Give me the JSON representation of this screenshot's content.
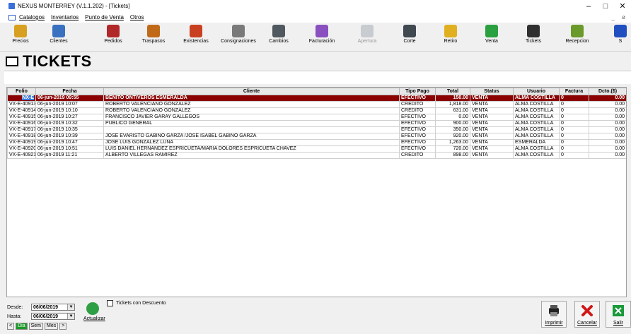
{
  "window": {
    "title": "NEXUS MONTERREY (V.1.1.202) - [Tickets]",
    "controls": [
      "–",
      "□",
      "✕"
    ]
  },
  "menu": {
    "items": [
      "Catalogos",
      "Inventarios",
      "Punto de Venta",
      "Otros"
    ],
    "mdi_controls": "_ ø"
  },
  "toolbar": [
    {
      "label": "Precios",
      "icon": "price-tag-icon",
      "color": "#d8a020",
      "enabled": true
    },
    {
      "label": "Clientes",
      "icon": "customers-icon",
      "color": "#3a70c0",
      "enabled": true
    },
    {
      "label": "Pedidos",
      "icon": "orders-icon",
      "color": "#b02828",
      "enabled": true
    },
    {
      "label": "Traspasos",
      "icon": "transfer-icon",
      "color": "#c06a18",
      "enabled": true
    },
    {
      "label": "Existencias",
      "icon": "stock-icon",
      "color": "#c84020",
      "enabled": true
    },
    {
      "label": "Consignaciones",
      "icon": "consignment-icon",
      "color": "#7a7a7a",
      "enabled": true
    },
    {
      "label": "Cambios",
      "icon": "exchange-icon",
      "color": "#505860",
      "enabled": true
    },
    {
      "label": "Facturación",
      "icon": "invoice-icon",
      "color": "#8a50c0",
      "enabled": true
    },
    {
      "label": "Apertura",
      "icon": "opening-icon",
      "color": "#c8ccd0",
      "enabled": false
    },
    {
      "label": "Corte",
      "icon": "cash-register-icon",
      "color": "#404850",
      "enabled": true
    },
    {
      "label": "Retiro",
      "icon": "withdrawal-icon",
      "color": "#e0b020",
      "enabled": true
    },
    {
      "label": "Venta",
      "icon": "sale-icon",
      "color": "#2aa040",
      "enabled": true
    },
    {
      "label": "Tickets",
      "icon": "ticket-icon",
      "color": "#303030",
      "enabled": true
    },
    {
      "label": "Recepcion",
      "icon": "reception-icon",
      "color": "#6a9a2a",
      "enabled": true
    },
    {
      "label": "S",
      "icon": "more-icon",
      "color": "#2050c0",
      "enabled": true
    }
  ],
  "page": {
    "title": "TICKETS"
  },
  "table": {
    "columns": [
      "Folio",
      "Fecha",
      "Cliente",
      "Tipo Pago",
      "Total",
      "Status",
      "Usuario",
      "Factura",
      "Dcto.($)"
    ],
    "rows": [
      [
        "NX-E",
        "06-jun-2019 09:55",
        "BENITO ONTIVEROS ESMERALDA",
        "EFECTIVO",
        "150.00",
        "VENTA",
        "ALMA COSTILLA",
        "0",
        "0.00"
      ],
      [
        "VX-E-40913",
        "06-jun-2019 10:07",
        "ROBERTO VALENCIANO GONZALEZ",
        "CREDITO",
        "1,818.00",
        "VENTA",
        "ALMA COSTILLA",
        "0",
        "0.00"
      ],
      [
        "VX-E-40914",
        "06-jun-2019 10:10",
        "ROBERTO VALENCIANO GONZALEZ",
        "CREDITO",
        "631.00",
        "VENTA",
        "ALMA COSTILLA",
        "0",
        "0.00"
      ],
      [
        "VX-E-40915",
        "06-jun-2019 10:27",
        "FRANCISCO JAVIER GARAY GALLEGOS",
        "EFECTIVO",
        "0.00",
        "VENTA",
        "ALMA COSTILLA",
        "0",
        "0.00"
      ],
      [
        "VX-E-40916",
        "06-jun-2019 10:32",
        "PUBLICO GENERAL",
        "EFECTIVO",
        "900.00",
        "VENTA",
        "ALMA COSTILLA",
        "0",
        "0.00"
      ],
      [
        "VX-E-40917",
        "06-jun-2019 10:35",
        "",
        "EFECTIVO",
        "350.00",
        "VENTA",
        "ALMA COSTILLA",
        "0",
        "0.00"
      ],
      [
        "VX-E-40918",
        "06-jun-2019 10:39",
        "JOSE EVARISTO GABIÑO GARZA /JOSE ISABEL GABIÑO GARZA",
        "EFECTIVO",
        "920.00",
        "VENTA",
        "ALMA COSTILLA",
        "0",
        "0.00"
      ],
      [
        "VX-E-40919",
        "06-jun-2019 10:47",
        "JOSE LUIS GONZALEZ LUNA",
        "EFECTIVO",
        "1,263.00",
        "VENTA",
        "ESMERALDA",
        "0",
        "0.00"
      ],
      [
        "VX-E-40920",
        "06-jun-2019 10:51",
        "LUIS DANIEL HERNANDEZ ESPRICUETA/MARIA DOLORES ESPRICUETA CHAVEZ",
        "EFECTIVO",
        "720.00",
        "VENTA",
        "ALMA COSTILLA",
        "0",
        "0.00"
      ],
      [
        "VX-E-40921",
        "06-jun-2019 11:21",
        "ALBERTO VILLEGAS RAMIREZ",
        "CREDITO",
        "898.00",
        "VENTA",
        "ALMA COSTILLA",
        "0",
        "0.00"
      ]
    ],
    "selected_row": 0
  },
  "filters": {
    "desde_label": "Desde:",
    "desde_value": "06/06/2019",
    "hasta_label": "Hasta:",
    "hasta_value": "06/06/2019",
    "nav": [
      "<",
      "Dia",
      "Sem",
      "Mes",
      ">"
    ],
    "refresh_label": "Actualizar",
    "discount_checkbox_label": "Tickets con Descuento",
    "discount_checked": false
  },
  "actions": {
    "print": "Imprimir",
    "cancel": "Cancelar",
    "exit": "Salir"
  }
}
